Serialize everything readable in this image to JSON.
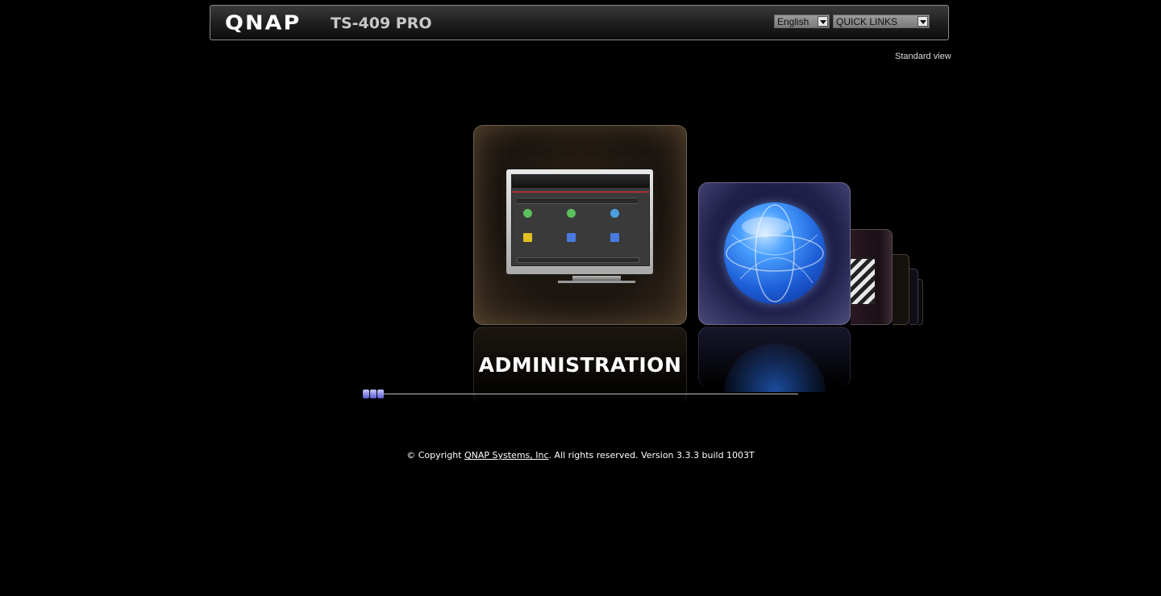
{
  "header": {
    "logo": "QNAP",
    "model": "TS-409 PRO",
    "language_select": "English",
    "quick_links_select": "QUICK LINKS"
  },
  "standard_view_link": "Standard view",
  "carousel": {
    "active_caption": "ADMINISTRATION",
    "items": [
      {
        "name": "administration",
        "icon": "monitor-icon"
      },
      {
        "name": "web-server",
        "icon": "globe-icon"
      },
      {
        "name": "multimedia",
        "icon": "clapperboard-icon"
      },
      {
        "name": "item-4",
        "icon": "app-icon"
      },
      {
        "name": "item-5",
        "icon": "app-icon"
      },
      {
        "name": "item-6",
        "icon": "app-icon"
      }
    ]
  },
  "footer": {
    "prefix": "© Copyright ",
    "company_link": "QNAP Systems, Inc",
    "suffix": ". All rights reserved. Version 3.3.3 build 1003T"
  }
}
